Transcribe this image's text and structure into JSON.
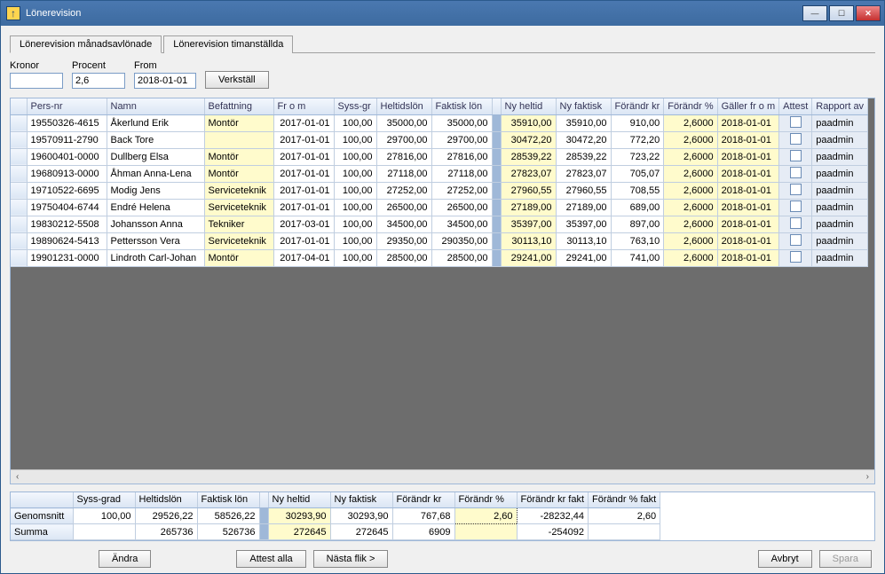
{
  "window": {
    "title": "Lönerevision"
  },
  "tabs": [
    {
      "label": "Lönerevision månadsavlönade",
      "active": true
    },
    {
      "label": "Lönerevision timanställda",
      "active": false
    }
  ],
  "form": {
    "kronor_label": "Kronor",
    "kronor_value": "",
    "procent_label": "Procent",
    "procent_value": "2,6",
    "from_label": "From",
    "from_value": "2018-01-01",
    "verkstall_label": "Verkställ"
  },
  "columns": [
    "Pers-nr",
    "Namn",
    "Befattning",
    "Fr o m",
    "Syss-gr",
    "Heltidslön",
    "Faktisk lön",
    "",
    "Ny heltid",
    "Ny faktisk",
    "Förändr kr",
    "Förändr %",
    "Gäller fr o m",
    "Attest",
    "Rapport av"
  ],
  "rows": [
    {
      "pnr": "19550326-4615",
      "namn": "Åkerlund Erik",
      "bef": "Montör",
      "from": "2017-01-01",
      "syss": "100,00",
      "heltid": "35000,00",
      "fakt": "35000,00",
      "nyh": "35910,00",
      "nyf": "35910,00",
      "fkr": "910,00",
      "fp": "2,6000",
      "gfrom": "2018-01-01",
      "rapp": "paadmin"
    },
    {
      "pnr": "19570911-2790",
      "namn": "Back Tore",
      "bef": "",
      "from": "2017-01-01",
      "syss": "100,00",
      "heltid": "29700,00",
      "fakt": "29700,00",
      "nyh": "30472,20",
      "nyf": "30472,20",
      "fkr": "772,20",
      "fp": "2,6000",
      "gfrom": "2018-01-01",
      "rapp": "paadmin"
    },
    {
      "pnr": "19600401-0000",
      "namn": "Dullberg Elsa",
      "bef": "Montör",
      "from": "2017-01-01",
      "syss": "100,00",
      "heltid": "27816,00",
      "fakt": "27816,00",
      "nyh": "28539,22",
      "nyf": "28539,22",
      "fkr": "723,22",
      "fp": "2,6000",
      "gfrom": "2018-01-01",
      "rapp": "paadmin"
    },
    {
      "pnr": "19680913-0000",
      "namn": "Åhman Anna-Lena",
      "bef": "Montör",
      "from": "2017-01-01",
      "syss": "100,00",
      "heltid": "27118,00",
      "fakt": "27118,00",
      "nyh": "27823,07",
      "nyf": "27823,07",
      "fkr": "705,07",
      "fp": "2,6000",
      "gfrom": "2018-01-01",
      "rapp": "paadmin"
    },
    {
      "pnr": "19710522-6695",
      "namn": "Modig Jens",
      "bef": "Serviceteknik",
      "from": "2017-01-01",
      "syss": "100,00",
      "heltid": "27252,00",
      "fakt": "27252,00",
      "nyh": "27960,55",
      "nyf": "27960,55",
      "fkr": "708,55",
      "fp": "2,6000",
      "gfrom": "2018-01-01",
      "rapp": "paadmin"
    },
    {
      "pnr": "19750404-6744",
      "namn": "Endré Helena",
      "bef": "Serviceteknik",
      "from": "2017-01-01",
      "syss": "100,00",
      "heltid": "26500,00",
      "fakt": "26500,00",
      "nyh": "27189,00",
      "nyf": "27189,00",
      "fkr": "689,00",
      "fp": "2,6000",
      "gfrom": "2018-01-01",
      "rapp": "paadmin"
    },
    {
      "pnr": "19830212-5508",
      "namn": "Johansson Anna",
      "bef": "Tekniker",
      "from": "2017-03-01",
      "syss": "100,00",
      "heltid": "34500,00",
      "fakt": "34500,00",
      "nyh": "35397,00",
      "nyf": "35397,00",
      "fkr": "897,00",
      "fp": "2,6000",
      "gfrom": "2018-01-01",
      "rapp": "paadmin"
    },
    {
      "pnr": "19890624-5413",
      "namn": "Pettersson Vera",
      "bef": "Serviceteknik",
      "from": "2017-01-01",
      "syss": "100,00",
      "heltid": "29350,00",
      "fakt": "290350,00",
      "nyh": "30113,10",
      "nyf": "30113,10",
      "fkr": "763,10",
      "fp": "2,6000",
      "gfrom": "2018-01-01",
      "rapp": "paadmin"
    },
    {
      "pnr": "19901231-0000",
      "namn": "Lindroth Carl-Johan",
      "bef": "Montör",
      "from": "2017-04-01",
      "syss": "100,00",
      "heltid": "28500,00",
      "fakt": "28500,00",
      "nyh": "29241,00",
      "nyf": "29241,00",
      "fkr": "741,00",
      "fp": "2,6000",
      "gfrom": "2018-01-01",
      "rapp": "paadmin"
    }
  ],
  "summary": {
    "columns": [
      "",
      "Syss-grad",
      "Heltidslön",
      "Faktisk lön",
      "",
      "Ny heltid",
      "Ny faktisk",
      "Förändr kr",
      "Förändr %",
      "Förändr kr fakt",
      "Förändr % fakt"
    ],
    "rows": [
      {
        "label": "Genomsnitt",
        "syss": "100,00",
        "heltid": "29526,22",
        "fakt": "58526,22",
        "nyh": "30293,90",
        "nyf": "30293,90",
        "fkr": "767,68",
        "fp": "2,60",
        "fkrf": "-28232,44",
        "fpf": "2,60"
      },
      {
        "label": "Summa",
        "syss": "",
        "heltid": "265736",
        "fakt": "526736",
        "nyh": "272645",
        "nyf": "272645",
        "fkr": "6909",
        "fp": "",
        "fkrf": "-254092",
        "fpf": ""
      }
    ]
  },
  "buttons": {
    "andra": "Ändra",
    "attest_alla": "Attest alla",
    "nasta_flik": "Nästa flik >",
    "avbryt": "Avbryt",
    "spara": "Spara"
  }
}
